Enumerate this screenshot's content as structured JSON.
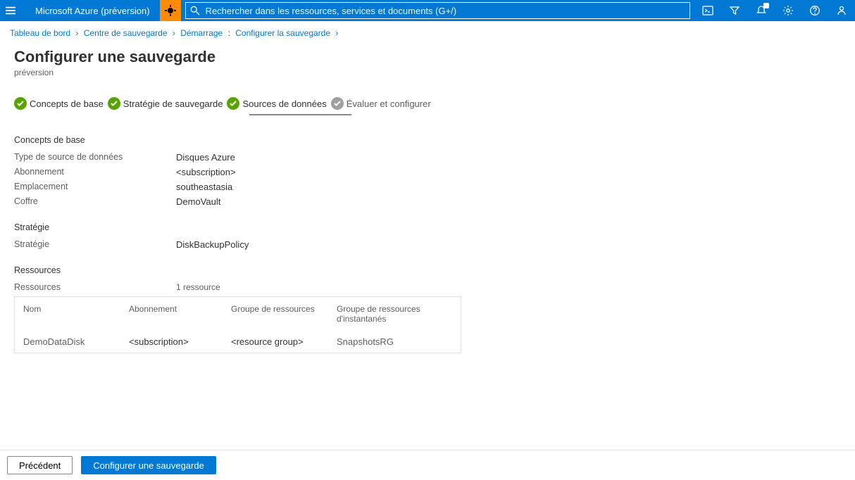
{
  "header": {
    "brand": "Microsoft Azure (préversion)",
    "search_placeholder": "Rechercher dans les ressources, services et documents (G+/)"
  },
  "breadcrumb": {
    "items": [
      "Tableau de bord",
      "Centre de sauvegarde",
      "Démarrage",
      "Configurer la sauvegarde"
    ]
  },
  "page": {
    "title": "Configurer une sauvegarde",
    "subtitle": "préversion"
  },
  "steps": {
    "s1": "Concepts de base",
    "s2": "Stratégie de sauvegarde",
    "s3": "Sources de données",
    "s4": "Évaluer et configurer"
  },
  "basics": {
    "heading": "Concepts de base",
    "datasource_label": "Type de source de données",
    "datasource_value": "Disques Azure",
    "subscription_label": "Abonnement",
    "subscription_value": "<subscription>",
    "location_label": "Emplacement",
    "location_value": "southeastasia",
    "vault_label": "Coffre",
    "vault_value": "DemoVault"
  },
  "policy": {
    "heading": "Stratégie",
    "policy_label": "Stratégie",
    "policy_value": "DiskBackupPolicy"
  },
  "resources": {
    "heading": "Ressources",
    "count_label": "Ressources",
    "count_value": "1 ressource",
    "cols": {
      "name": "Nom",
      "subscription": "Abonnement",
      "rg": "Groupe de ressources",
      "snaprg": "Groupe de ressources d'instantanés"
    },
    "row": {
      "name": "DemoDataDisk",
      "subscription": "<subscription>",
      "rg": "<resource group>",
      "snaprg": "SnapshotsRG"
    }
  },
  "footer": {
    "prev": "Précédent",
    "configure": "Configurer une sauvegarde"
  }
}
